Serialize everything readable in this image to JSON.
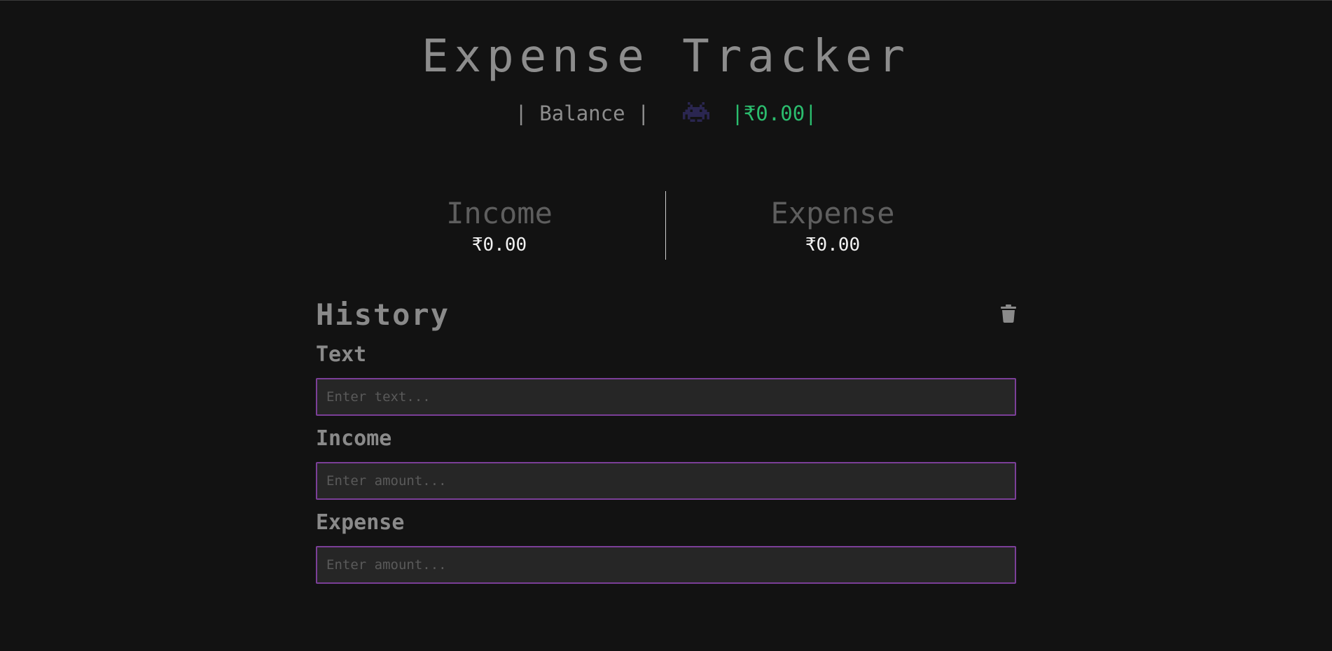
{
  "header": {
    "title": "Expense Tracker",
    "balance_label": "| Balance |",
    "balance_value": "|₹0.00|",
    "balance_icon": "space-invader-icon",
    "balance_color": "#2bbd6e"
  },
  "summary": {
    "income_label": "Income",
    "income_value": "₹0.00",
    "expense_label": "Expense",
    "expense_value": "₹0.00"
  },
  "history": {
    "title": "History",
    "clear_icon": "trash-icon"
  },
  "form": {
    "text_label": "Text",
    "text_placeholder": "Enter text...",
    "income_label": "Income",
    "income_placeholder": "Enter amount...",
    "expense_label": "Expense",
    "expense_placeholder": "Enter amount...",
    "border_color": "#7b3f98"
  }
}
